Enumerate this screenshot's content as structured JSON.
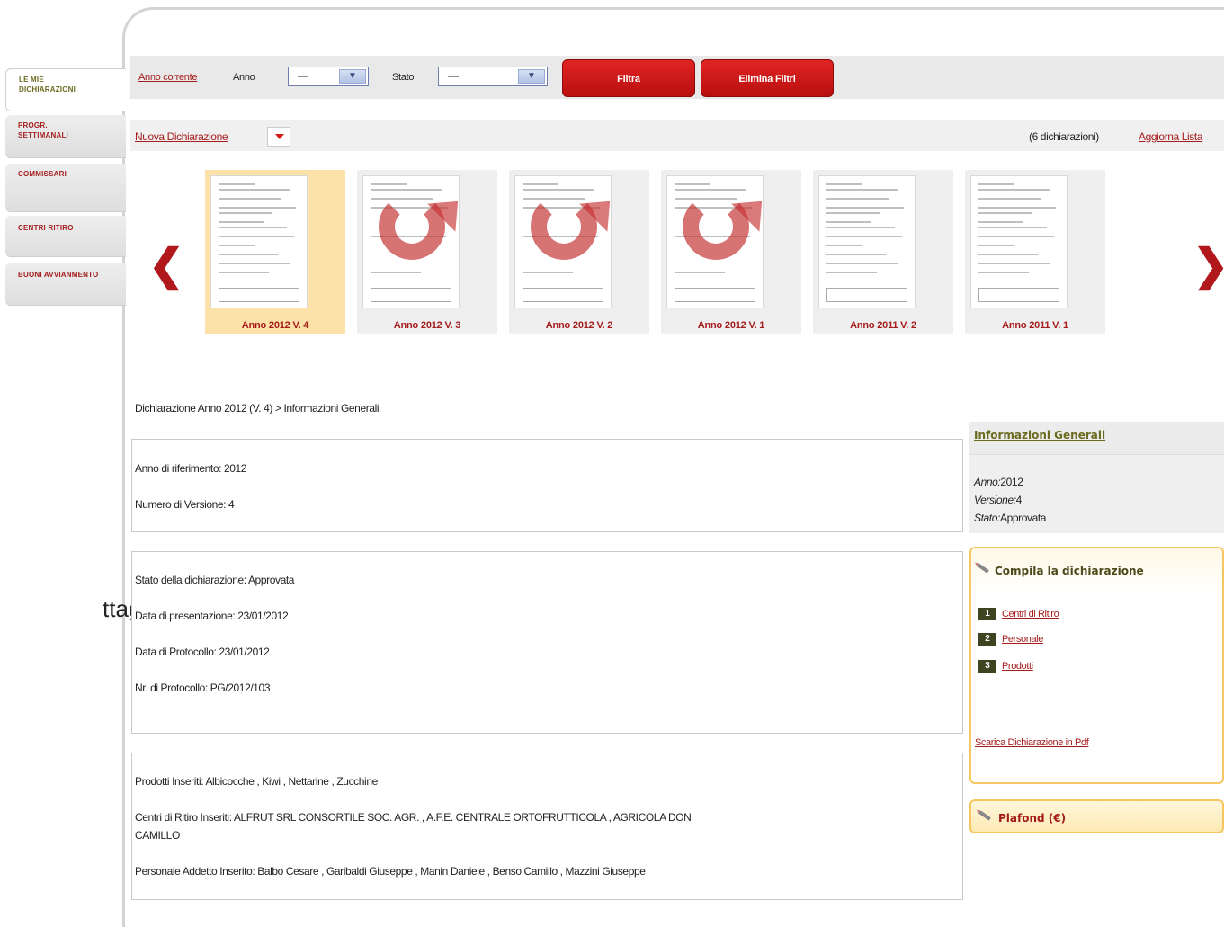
{
  "sidebar": {
    "items": [
      {
        "label_line1": "Le mie",
        "label_line2": "dichiarazioni"
      },
      {
        "label_line1": "Progr.",
        "label_line2": "Settimanali"
      },
      {
        "label_line1": "Commissari",
        "label_line2": ""
      },
      {
        "label_line1": "Centri ritiro",
        "label_line2": ""
      },
      {
        "label_line1": "Buoni Avvianmento",
        "label_line2": ""
      }
    ],
    "cut_label": "ttaglio"
  },
  "filters": {
    "current_year_link": "Anno corrente",
    "year_label": "Anno",
    "year_value": "—",
    "state_label": "Stato",
    "state_value": "—",
    "filter_button": "Filtra",
    "clear_button": "Elimina Filtri"
  },
  "listbar": {
    "new_declaration": "Nuova Dichiarazione",
    "count_text": "(6 dichiarazioni)",
    "refresh_link": "Aggiorna Lista"
  },
  "carousel": {
    "prev_glyph": "❮",
    "next_glyph": "❯",
    "items": [
      {
        "caption": "Anno 2012 V. 4"
      },
      {
        "caption": "Anno 2012 V. 3"
      },
      {
        "caption": "Anno 2012 V. 2"
      },
      {
        "caption": "Anno 2012 V. 1"
      },
      {
        "caption": "Anno 2011 V. 2"
      },
      {
        "caption": "Anno 2011 V. 1"
      }
    ]
  },
  "breadcrumb": "Dichiarazione Anno 2012 (V. 4) > Informazioni Generali",
  "box1": {
    "year_ref": "Anno di riferimento: 2012",
    "version_num": "Numero di Versione: 4"
  },
  "box2": {
    "state": "Stato della dichiarazione: Approvata",
    "submission_date": "Data di presentazione: 23/01/2012",
    "protocol_date": "Data di Protocollo: 23/01/2012",
    "protocol_nr": "Nr. di Protocollo: PG/2012/103"
  },
  "box3": {
    "products": "Prodotti Inseriti: Albicocche , Kiwi , Nettarine , Zucchine",
    "centers_line1": "Centri di Ritiro Inseriti: ALFRUT SRL CONSORTILE SOC. AGR. , A.F.E. CENTRALE ORTOFRUTTICOLA , AGRICOLA DON",
    "centers_line2": "CAMILLO",
    "staff": "Personale Addetto Inserito: Balbo Cesare , Garibaldi Giuseppe , Manin Daniele , Benso Camillo , Mazzini Giuseppe"
  },
  "info_panel": {
    "title": "Informazioni Generali",
    "year_key": "Anno:",
    "year_val": "2012",
    "version_key": "Versione:",
    "version_val": "4",
    "state_key": "Stato:",
    "state_val": "Approvata"
  },
  "compile_panel": {
    "title": "Compila la dichiarazione",
    "steps": [
      {
        "num": "1",
        "label": "Centri di Ritiro"
      },
      {
        "num": "2",
        "label": "Personale"
      },
      {
        "num": "3",
        "label": "Prodotti"
      }
    ],
    "pdf_link": "Scarica Dichiarazione in Pdf"
  },
  "plafond_panel": {
    "title": "Plafond (€)"
  }
}
